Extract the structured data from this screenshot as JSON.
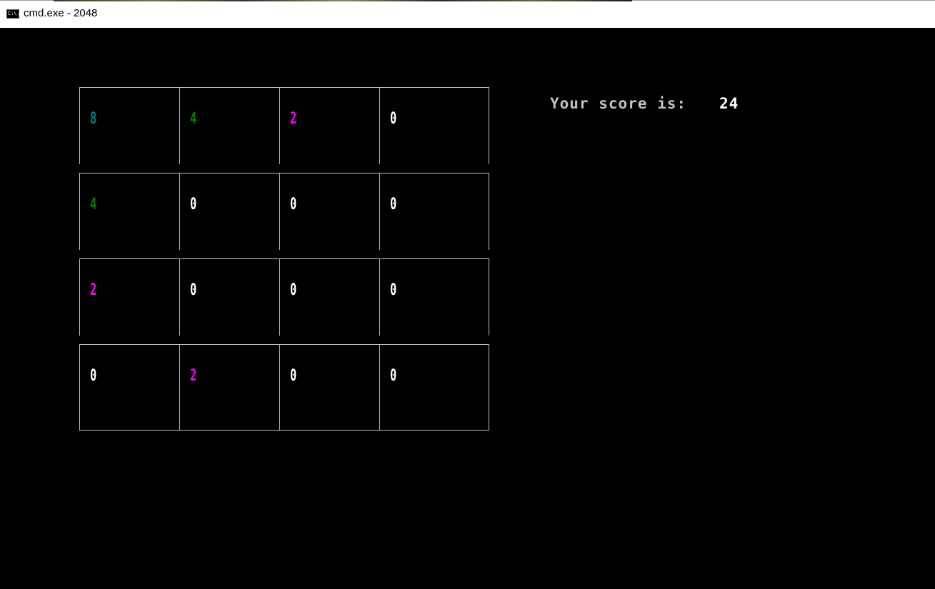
{
  "window": {
    "title": "cmd.exe - 2048",
    "icon": "cmd-console-icon",
    "icon_text": "C:\\."
  },
  "colors": {
    "background": "#000000",
    "grid_line": "#c0c0c0",
    "value_8": "#008080",
    "value_4": "#008000",
    "value_2": "#ff00ff",
    "value_0": "#ffffff",
    "score_label": "#c0c0c0",
    "score_value": "#ffffff"
  },
  "board": {
    "rows": [
      [
        "8",
        "4",
        "2",
        "0"
      ],
      [
        "4",
        "0",
        "0",
        "0"
      ],
      [
        "2",
        "0",
        "0",
        "0"
      ],
      [
        "0",
        "2",
        "0",
        "0"
      ]
    ]
  },
  "score": {
    "label": "Your score is:",
    "value": "24"
  }
}
